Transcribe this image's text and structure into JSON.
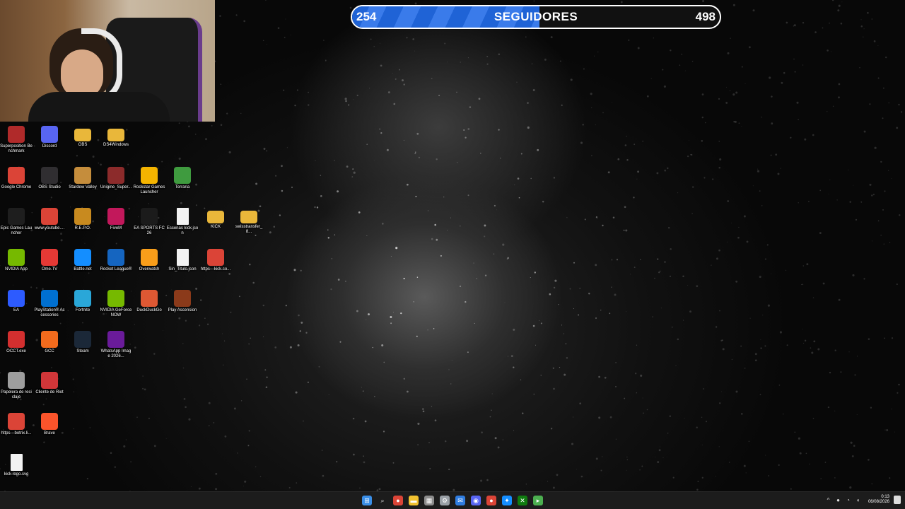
{
  "follower_goal": {
    "current": "254",
    "label": "SEGUIDORES",
    "target": "498",
    "progress": 0.51,
    "color": "#2a6fe0"
  },
  "desktop_icons": [
    {
      "label": "Superposition Benchmark",
      "icon": "superposition-icon",
      "color": "#b02a2a"
    },
    {
      "label": "Discord",
      "icon": "discord-icon",
      "color": "#5865f2"
    },
    {
      "label": "OBS",
      "icon": "folder-icon",
      "color": "#e9b73a"
    },
    {
      "label": "DS4Windows",
      "icon": "folder-icon",
      "color": "#e9b73a"
    },
    {
      "label": "Google Chrome",
      "icon": "chrome-icon",
      "color": "#db4437"
    },
    {
      "label": "OBS Studio",
      "icon": "obs-icon",
      "color": "#302e31"
    },
    {
      "label": "Stardew Valley",
      "icon": "stardew-icon",
      "color": "#c58d3c"
    },
    {
      "label": "Unigine_Super...",
      "icon": "unigine-icon",
      "color": "#8c2b2b"
    },
    {
      "label": "Rockstar Games Launcher",
      "icon": "rockstar-icon",
      "color": "#f4b400"
    },
    {
      "label": "Terraria",
      "icon": "terraria-icon",
      "color": "#3f9b3f"
    },
    {
      "label": "Epic Games Launcher",
      "icon": "epic-icon",
      "color": "#1e1e1e"
    },
    {
      "label": "www.youtube....",
      "icon": "chrome-file-icon",
      "color": "#db4437"
    },
    {
      "label": "R.E.P.O.",
      "icon": "repo-icon",
      "color": "#c88a1f"
    },
    {
      "label": "FiveM",
      "icon": "fivem-icon",
      "color": "#c2185b"
    },
    {
      "label": "EA SPORTS FC 26",
      "icon": "easports-icon",
      "color": "#1b1b1b"
    },
    {
      "label": "Escenas kick.json",
      "icon": "file-icon",
      "color": "#f2f2f2"
    },
    {
      "label": "KICK",
      "icon": "folder-icon",
      "color": "#e9b73a"
    },
    {
      "label": "swisstransfer_8...",
      "icon": "zip-folder-icon",
      "color": "#e9b73a"
    },
    {
      "label": "NVIDIA App",
      "icon": "nvidia-icon",
      "color": "#76b900"
    },
    {
      "label": "Ome.TV",
      "icon": "ometv-icon",
      "color": "#e53935"
    },
    {
      "label": "Battle.net",
      "icon": "battlenet-icon",
      "color": "#148eff"
    },
    {
      "label": "Rocket League®",
      "icon": "rocketleague-icon",
      "color": "#1565c0"
    },
    {
      "label": "Overwatch",
      "icon": "overwatch-icon",
      "color": "#f99e1a"
    },
    {
      "label": "Sin_Titulo.json",
      "icon": "file-icon",
      "color": "#f2f2f2"
    },
    {
      "label": "https---kick.co...",
      "icon": "chrome-file-icon",
      "color": "#db4437"
    },
    {
      "label": "EA",
      "icon": "ea-icon",
      "color": "#2d5bff"
    },
    {
      "label": "PlayStation® Accessories",
      "icon": "playstation-icon",
      "color": "#0070d1"
    },
    {
      "label": "Fortnite",
      "icon": "fortnite-icon",
      "color": "#2aa7d8"
    },
    {
      "label": "NVIDIA GeForce NOW",
      "icon": "geforcenow-icon",
      "color": "#76b900"
    },
    {
      "label": "DuckDuckGo",
      "icon": "duckduckgo-icon",
      "color": "#de5833"
    },
    {
      "label": "Play Ascension",
      "icon": "ascension-icon",
      "color": "#8b3a1a"
    },
    {
      "label": "OCCT.exe",
      "icon": "occt-icon",
      "color": "#d32f2f"
    },
    {
      "label": "GCC",
      "icon": "gcc-icon",
      "color": "#f26b1d"
    },
    {
      "label": "Steam",
      "icon": "steam-icon",
      "color": "#1b2838"
    },
    {
      "label": "WhatsApp Image 2026...",
      "icon": "image-icon",
      "color": "#6a1b9a"
    },
    {
      "label": "Papelera de reciclaje",
      "icon": "recycle-bin-icon",
      "color": "#9e9e9e"
    },
    {
      "label": "Cliente de Riot",
      "icon": "riot-icon",
      "color": "#d13639"
    },
    {
      "label": "https---botrix.li...",
      "icon": "chrome-file-icon",
      "color": "#db4437"
    },
    {
      "label": "Brave",
      "icon": "brave-icon",
      "color": "#fb542b"
    },
    {
      "label": "kick-logo.svg",
      "icon": "file-icon",
      "color": "#f2f2f2"
    }
  ],
  "taskbar": {
    "apps": [
      "windows-start-icon",
      "search-icon",
      "chrome-icon",
      "file-explorer-icon",
      "calendar-icon",
      "settings-icon",
      "mail-icon",
      "discord-icon",
      "chrome-alt-icon",
      "battlenet-icon",
      "xbox-icon",
      "terminal-icon"
    ],
    "time": "0:13",
    "date": "06/08/2026"
  }
}
